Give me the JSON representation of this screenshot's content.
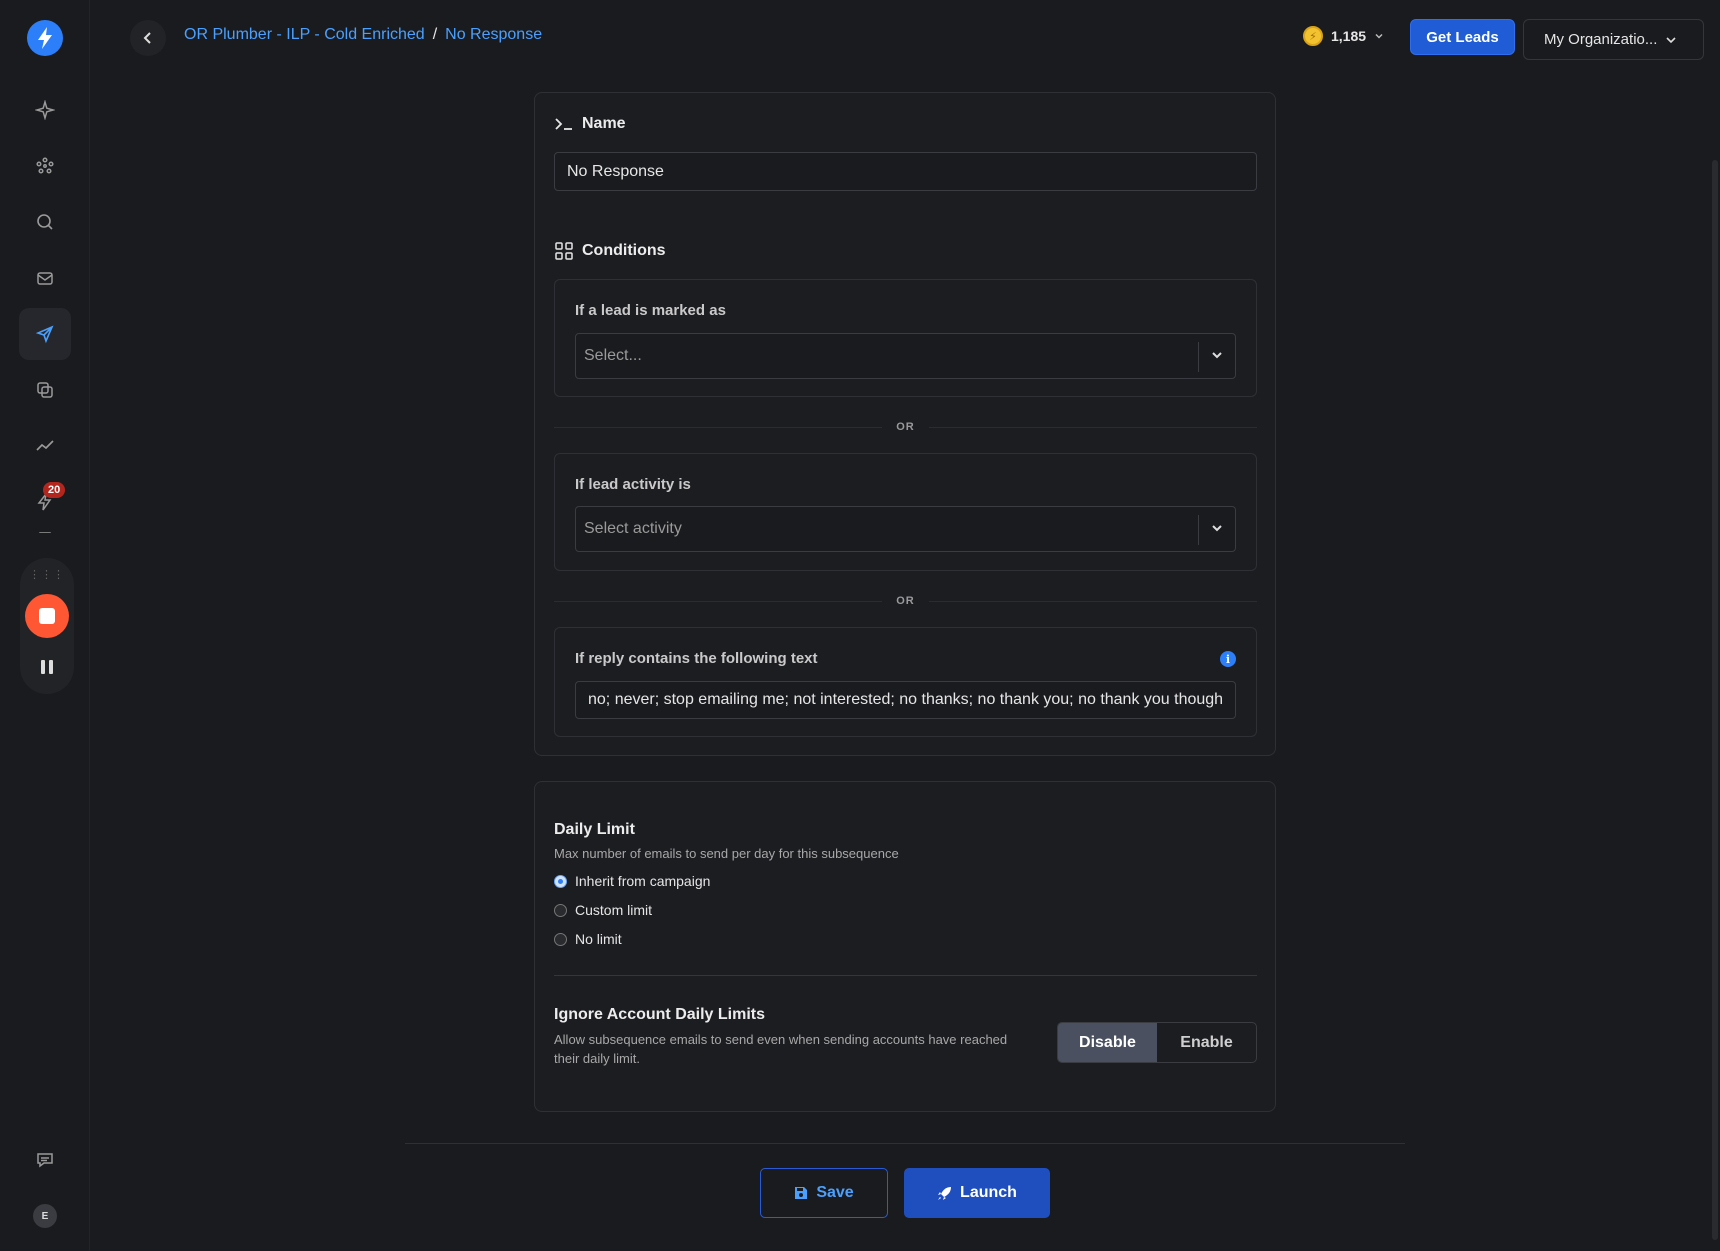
{
  "breadcrumb": {
    "campaign": "OR Plumber - ILP - Cold Enriched",
    "separator": "/",
    "current": "No Response"
  },
  "header": {
    "credits": "1,185",
    "get_leads_label": "Get Leads",
    "org_label": "My Organizatio..."
  },
  "sidebar": {
    "items": [
      {
        "icon": "sparkle-icon"
      },
      {
        "icon": "network-icon"
      },
      {
        "icon": "search-icon"
      },
      {
        "icon": "mail-icon"
      },
      {
        "icon": "send-icon",
        "active": true
      },
      {
        "icon": "copy-icon"
      },
      {
        "icon": "analytics-icon"
      },
      {
        "icon": "bolt-icon",
        "badge": "20"
      },
      {
        "icon": "bell-icon"
      }
    ],
    "avatar_initial": "E"
  },
  "form": {
    "name_label": "Name",
    "name_value": "No Response",
    "conditions_label": "Conditions",
    "marked_as_label": "If a lead is marked as",
    "marked_as_placeholder": "Select...",
    "or_label": "OR",
    "activity_label": "If lead activity is",
    "activity_placeholder": "Select activity",
    "reply_label": "If reply contains the following text",
    "reply_value": "no; never; stop emailing me; not interested; no thanks; no thank you; no thank you though"
  },
  "daily_limit": {
    "title": "Daily Limit",
    "description": "Max number of emails to send per day for this subsequence",
    "options": [
      {
        "label": "Inherit from campaign",
        "selected": true
      },
      {
        "label": "Custom limit",
        "selected": false
      },
      {
        "label": "No limit",
        "selected": false
      }
    ]
  },
  "ignore_limits": {
    "title": "Ignore Account Daily Limits",
    "description": "Allow subsequence emails to send even when sending accounts have reached their daily limit.",
    "disable_label": "Disable",
    "enable_label": "Enable",
    "selected": "Disable"
  },
  "footer": {
    "save_label": "Save",
    "launch_label": "Launch"
  },
  "colors": {
    "accent": "#2d7ff9",
    "primary_button": "#1f5cd6",
    "record": "#ff5733"
  }
}
